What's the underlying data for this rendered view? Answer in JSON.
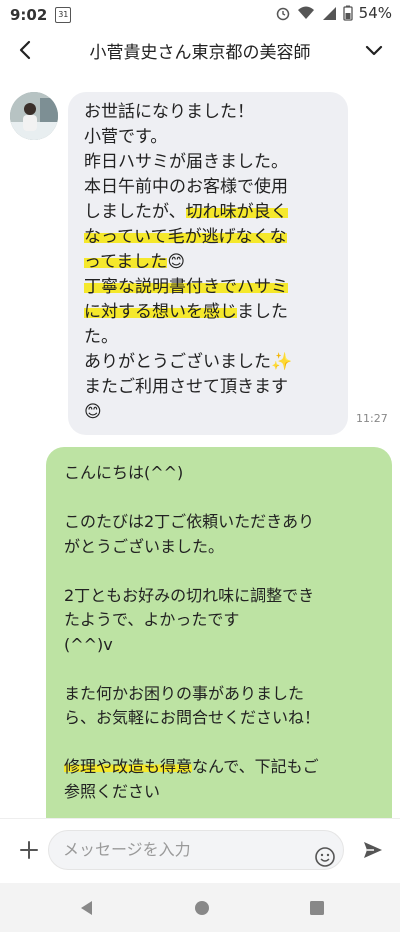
{
  "status": {
    "time": "9:02",
    "calendar_day": "31",
    "battery": "54%"
  },
  "header": {
    "title": "小菅貴史さん東京都の美容師"
  },
  "incoming": {
    "time": "11:27",
    "lines": [
      [
        "お世話になりました！"
      ],
      [
        "小菅です。"
      ],
      [
        "昨日ハサミが届きました。"
      ],
      [
        "本日午前中のお客様で使用"
      ],
      [
        "しましたが、",
        "切れ味が良く"
      ],
      [
        "なっていて毛が逃げなくな"
      ],
      [
        "ってました",
        "😊"
      ],
      [
        "丁寧な説明書付きでハサミ"
      ],
      [
        "に対する想いを感じ",
        "ました"
      ],
      [
        "た。"
      ],
      [
        "ありがとうございました",
        "✨"
      ],
      [
        "またご利用させて頂きます"
      ],
      [
        "😊"
      ]
    ]
  },
  "outgoing": {
    "lines": [
      [
        "こんにちは(^^)"
      ],
      [
        ""
      ],
      [
        "このたびは2丁ご依頼いただきあり"
      ],
      [
        "がとうございました。"
      ],
      [
        ""
      ],
      [
        "2丁ともお好みの切れ味に調整でき"
      ],
      [
        "たようで、よかったです"
      ],
      [
        "(^^)v"
      ],
      [
        ""
      ],
      [
        "また何かお困りの事がありました"
      ],
      [
        "ら、お気軽にお問合せくださいね！"
      ],
      [
        ""
      ],
      [
        "修理や改造も得意",
        "なんで、下記もご"
      ],
      [
        "参照ください"
      ]
    ]
  },
  "composer": {
    "placeholder": "メッセージを入力"
  },
  "icons": {
    "back": "chevron-left-icon",
    "menu": "chevron-down-icon",
    "plus": "plus-icon",
    "emoji": "smiley-icon",
    "send": "send-icon"
  },
  "colors": {
    "incoming_bubble": "#eeeff3",
    "outgoing_bubble": "#bde3a3",
    "highlight": "#f5e82c"
  }
}
